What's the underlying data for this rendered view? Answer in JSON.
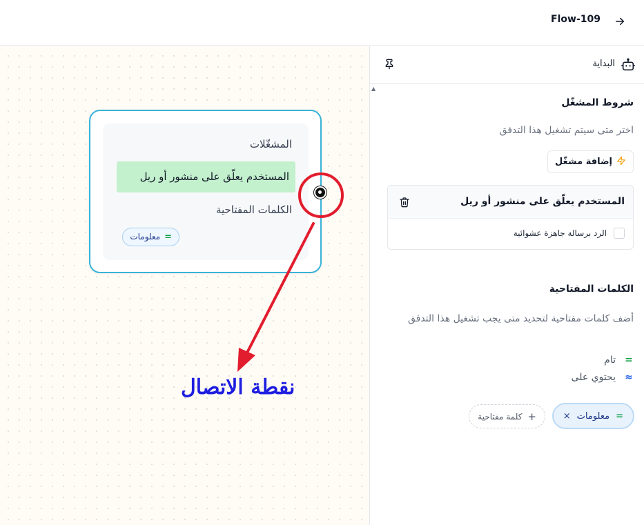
{
  "header": {
    "flow_title": "Flow-109",
    "back_icon": "arrow-right-icon"
  },
  "canvas": {
    "node": {
      "triggers_title": "المشغّلات",
      "trigger_text": "المستخدم يعلّق على منشور أو ريل",
      "keywords_title": "الكلمات المفتاحية",
      "keyword_pill": "معلومات",
      "keyword_match_symbol": "="
    },
    "annotation": {
      "label": "نقطة الاتصال",
      "color": "#e11d2e",
      "label_color": "#1e1ee0"
    }
  },
  "panel": {
    "header": {
      "title": "البداية",
      "start_icon": "robot-icon",
      "pin_icon": "pin-icon"
    },
    "trigger_conditions": {
      "title": "شروط المشغّل",
      "description": "اختر متى سيتم تشغيل هذا التدفق",
      "add_button": "إضافة مشغّل",
      "card": {
        "title": "المستخدم يعلّق على منشور أو ريل",
        "option": "الرد برسالة جاهزة عشوائية",
        "option_checked": false
      }
    },
    "keywords": {
      "title": "الكلمات المفتاحية",
      "description": "أضف كلمات مفتاحية لتحديد متى يجب تشغيل هذا التدفق",
      "match_exact_symbol": "=",
      "match_exact": "تام",
      "match_contains_symbol": "≈",
      "match_contains": "يحتوي على",
      "tags": [
        {
          "symbol": "=",
          "label": "معلومات",
          "remove": "×"
        }
      ],
      "add_button": "كلمة مفتاحية",
      "add_symbol": "+"
    }
  },
  "colors": {
    "accent": "#38b2d8",
    "trigger_chip": "#c3f0cd",
    "exact_green": "#16a34a",
    "contains_blue": "#2563eb"
  }
}
